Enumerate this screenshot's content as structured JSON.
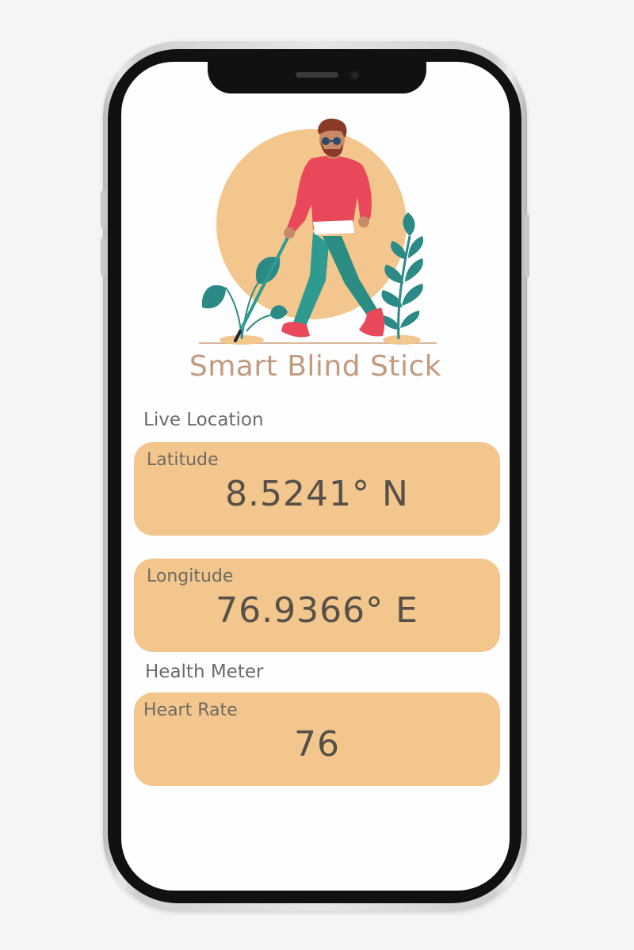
{
  "app": {
    "title": "Smart Blind Stick"
  },
  "live_location": {
    "section_label": "Live Location",
    "latitude": {
      "label": "Latitude",
      "value": "8.5241° N"
    },
    "longitude": {
      "label": "Longitude",
      "value": "76.9366° E"
    }
  },
  "health_meter": {
    "section_label": "Health Meter",
    "heart_rate": {
      "label": "Heart Rate",
      "value": "76"
    }
  },
  "colors": {
    "card_background": "#f2c68c",
    "title_color": "#c29a80",
    "label_color": "#6b6b6b",
    "value_color": "#555049",
    "illustration_circle": "#f2c68c",
    "sweater": "#e8485a",
    "pants": "#2e9a90",
    "plants": "#2b8a86"
  },
  "illustration": {
    "icon": "blind-man-walking-with-cane-illustration"
  }
}
